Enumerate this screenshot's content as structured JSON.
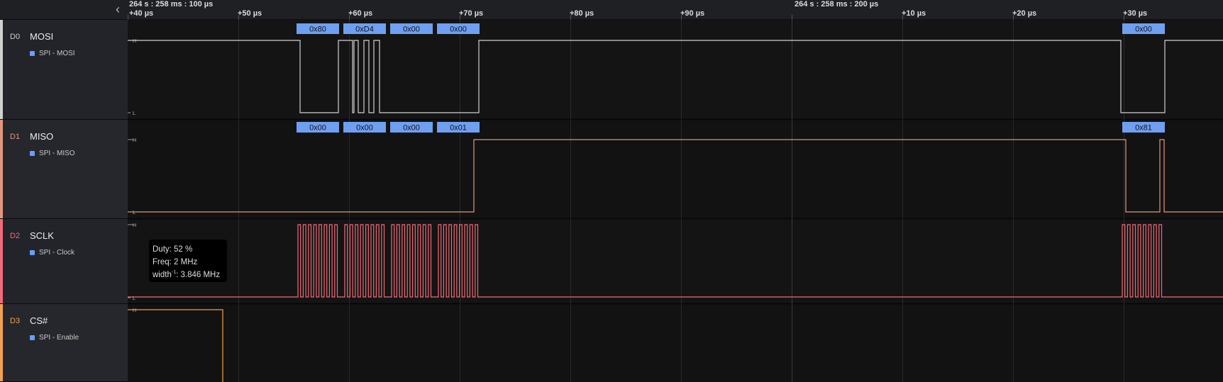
{
  "ruler": {
    "anchor_left": "264 s : 258 ms : 100 µs",
    "anchor_right": "264 s : 258 ms : 200 µs",
    "ticks": [
      "+40 µs",
      "+50 µs",
      "+60 µs",
      "+70 µs",
      "+80 µs",
      "+90 µs",
      "+10 µs",
      "+20 µs",
      "+30 µs"
    ]
  },
  "channels": [
    {
      "id": "D0",
      "name": "MOSI",
      "analyzer": "SPI - MOSI",
      "color": "#d0d0d0"
    },
    {
      "id": "D1",
      "name": "MISO",
      "analyzer": "SPI - MISO",
      "color": "#e2967e"
    },
    {
      "id": "D2",
      "name": "SCLK",
      "analyzer": "SPI - Clock",
      "color": "#f06a79"
    },
    {
      "id": "D3",
      "name": "CS#",
      "analyzer": "SPI - Enable",
      "color": "#f3a04f"
    }
  ],
  "level_labels": {
    "high": "H",
    "low": "L"
  },
  "mosi_bytes": [
    "0x80",
    "0xD4",
    "0x00",
    "0x00",
    "0x00"
  ],
  "miso_bytes": [
    "0x00",
    "0x00",
    "0x00",
    "0x01",
    "0x81"
  ],
  "tooltip": {
    "duty": "Duty: 52 %",
    "freq": "Freq: 2 MHz",
    "width_prefix": "width",
    "width_sup": "-1",
    "width_value": ": 3.846 MHz"
  },
  "colors": {
    "byte_box": "#6f9ff0",
    "grid": "#2c2c2c",
    "background": "#141414"
  }
}
